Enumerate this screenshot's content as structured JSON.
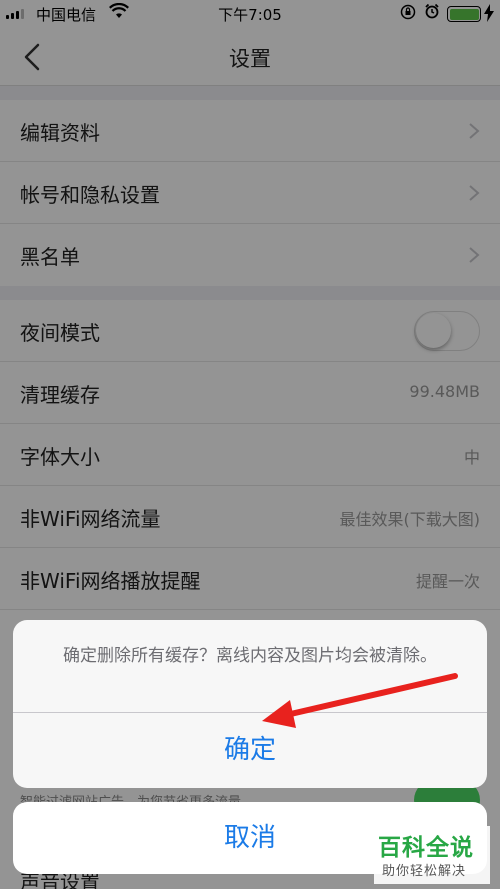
{
  "status_bar": {
    "carrier": "中国电信",
    "time": "下午7:05"
  },
  "nav": {
    "title": "设置"
  },
  "group1": [
    {
      "label": "编辑资料"
    },
    {
      "label": "帐号和隐私设置"
    },
    {
      "label": "黑名单"
    }
  ],
  "group2": {
    "night_mode": {
      "label": "夜间模式",
      "on": false
    },
    "clear_cache": {
      "label": "清理缓存",
      "value": "99.48MB"
    },
    "font_size": {
      "label": "字体大小",
      "value": "中"
    },
    "non_wifi_traffic": {
      "label": "非WiFi网络流量",
      "value": "最佳效果(下载大图)"
    },
    "non_wifi_play": {
      "label": "非WiFi网络播放提醒",
      "value": "提醒一次"
    }
  },
  "below": {
    "partial_text": "智能过滤网站广告，为您节省更多流量",
    "partial_label": "声音设置"
  },
  "dialog": {
    "message": "确定删除所有缓存？离线内容及图片均会被清除。",
    "confirm": "确定",
    "cancel": "取消"
  },
  "watermark": {
    "main": "百科全说",
    "sub": "助你轻松解决"
  },
  "colors": {
    "accent": "#1b7be7",
    "toggle_on": "#4cd964",
    "arrow": "#e8221e"
  }
}
